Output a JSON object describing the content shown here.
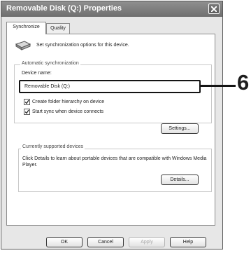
{
  "window": {
    "title": "Removable Disk (Q:) Properties"
  },
  "tabs": [
    {
      "label": "Synchronize",
      "active": true
    },
    {
      "label": "Quality",
      "active": false
    }
  ],
  "intro_text": "Set synchronization options for this device.",
  "auto_sync": {
    "group_title": "Automatic synchronization",
    "device_name_label": "Device name:",
    "device_name_value": "Removable Disk (Q:)",
    "checkboxes": [
      {
        "label": "Create folder hierarchy on device",
        "checked": true
      },
      {
        "label": "Start sync when device connects",
        "checked": true
      }
    ],
    "settings_button": "Settings..."
  },
  "supported_devices": {
    "group_title": "Currently supported devices",
    "description": "Click Details to learn about portable devices that are compatible with Windows Media Player.",
    "details_button": "Details..."
  },
  "footer_buttons": {
    "ok": "OK",
    "cancel": "Cancel",
    "apply": "Apply",
    "help": "Help"
  },
  "callout": {
    "number": "6"
  },
  "icons": {
    "device": "portable-device-icon",
    "close": "close-icon",
    "check": "checkmark-icon"
  }
}
